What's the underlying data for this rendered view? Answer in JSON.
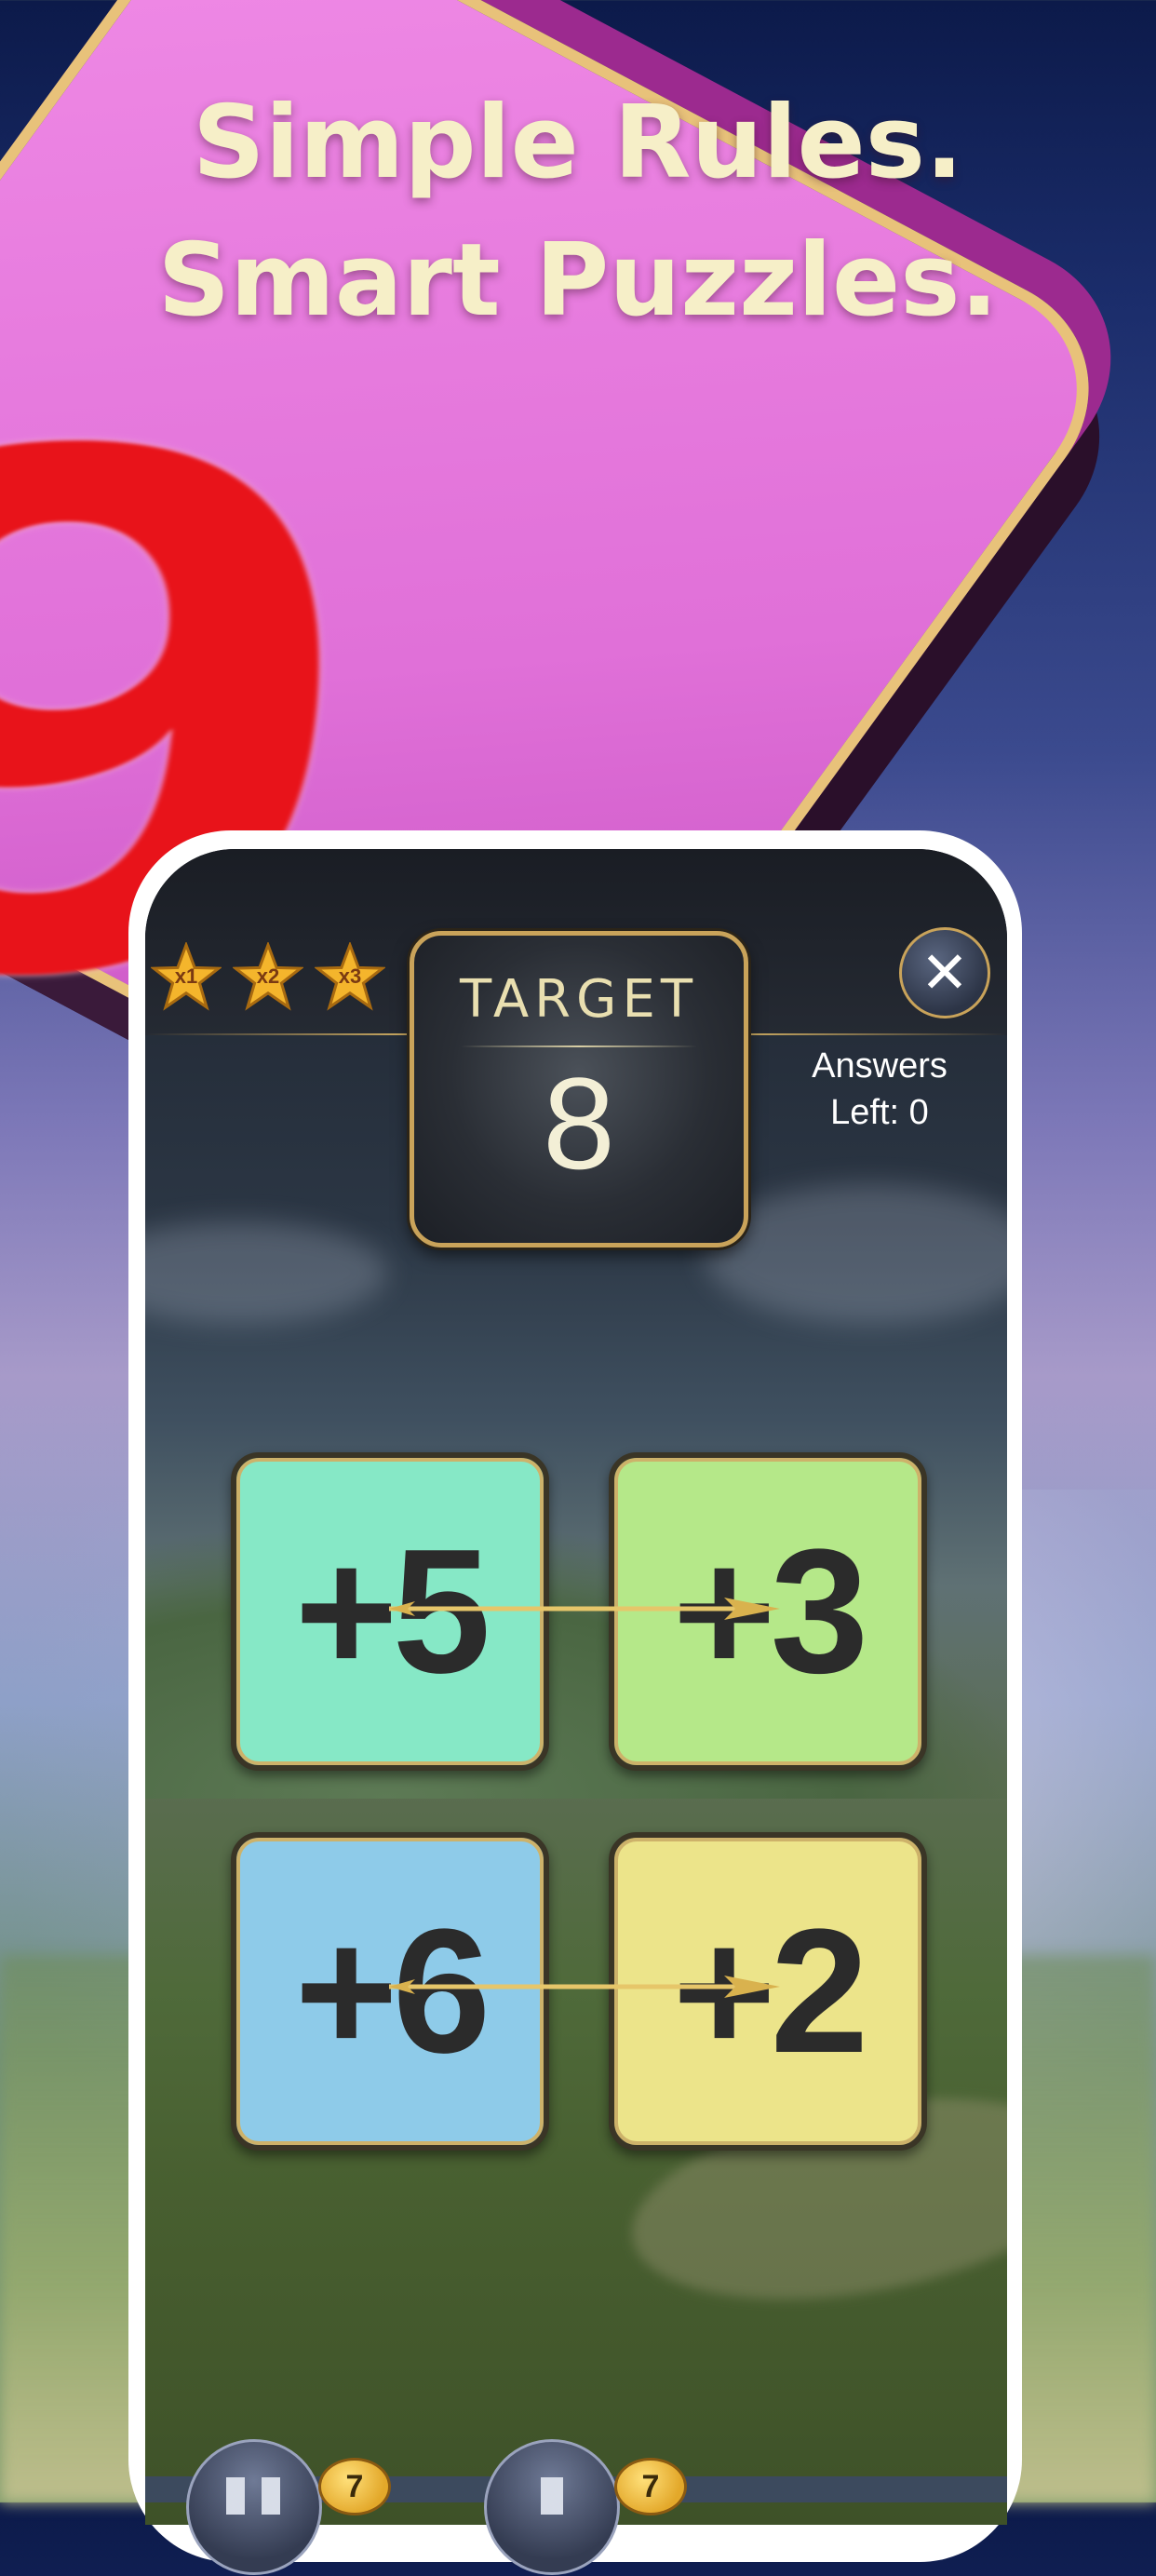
{
  "headline": {
    "line1": "Simple Rules.",
    "line2": "Smart Puzzles."
  },
  "decor": {
    "big_tile_digit": "9"
  },
  "game": {
    "stars": [
      {
        "label": "x1",
        "icon": "star-icon"
      },
      {
        "label": "x2",
        "icon": "star-icon"
      },
      {
        "label": "x3",
        "icon": "star-icon"
      }
    ],
    "target_label": "TARGET",
    "target_value": "8",
    "answers_line1": "Answers",
    "answers_line2": "Left: 0",
    "close_icon": "close-icon",
    "tiles": [
      {
        "label": "+5",
        "color": "#86e8c6"
      },
      {
        "label": "+3",
        "color": "#b5e889"
      },
      {
        "label": "+6",
        "color": "#8ecbe9"
      },
      {
        "label": "+2",
        "color": "#ece48a"
      }
    ],
    "bottom_buttons": [
      {
        "icon": "pause-icon",
        "coin": "7"
      },
      {
        "icon": "hint-icon",
        "coin": "7"
      }
    ]
  },
  "colors": {
    "tile_pink": "#e070d8",
    "digit_red": "#e8131a",
    "gold": "#c9a35a",
    "headline": "#f6efc8"
  }
}
